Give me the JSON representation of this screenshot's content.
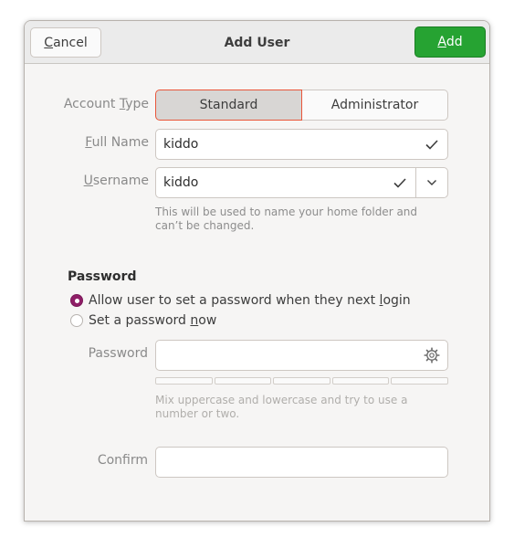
{
  "header": {
    "title": "Add User",
    "cancel_label": "Cancel",
    "cancel_mnemonic": "C",
    "cancel_rest": "ancel",
    "add_label": "Add",
    "add_mnemonic": "A",
    "add_rest": "dd"
  },
  "account_type": {
    "label_pre": "Account ",
    "label_mnemonic": "T",
    "label_rest": "ype",
    "options": [
      "Standard",
      "Administrator"
    ],
    "selected": "Standard"
  },
  "full_name": {
    "label_mnemonic": "F",
    "label_rest": "ull Name",
    "value": "kiddo"
  },
  "username": {
    "label_mnemonic": "U",
    "label_rest": "sername",
    "value": "kiddo",
    "hint": "This will be used to name your home folder and can’t be changed."
  },
  "password_section": {
    "title": "Password",
    "option_later_pre": "Allow user to set a password when they next ",
    "option_later_mnemonic": "l",
    "option_later_rest": "ogin",
    "option_now_pre": "Set a password ",
    "option_now_mnemonic": "n",
    "option_now_rest": "ow",
    "selected": "later",
    "password_label": "Password",
    "password_value": "",
    "strength_hint": "Mix uppercase and lowercase and try to use a number or two.",
    "confirm_label": "Confirm",
    "confirm_value": ""
  },
  "icons": {
    "valid": "checkmark-icon",
    "dropdown": "chevron-down-icon",
    "generate": "generate-password-icon"
  },
  "colors": {
    "accent": "#8f1e67",
    "add_button": "#26a332",
    "selected_outline": "#e9563a"
  }
}
